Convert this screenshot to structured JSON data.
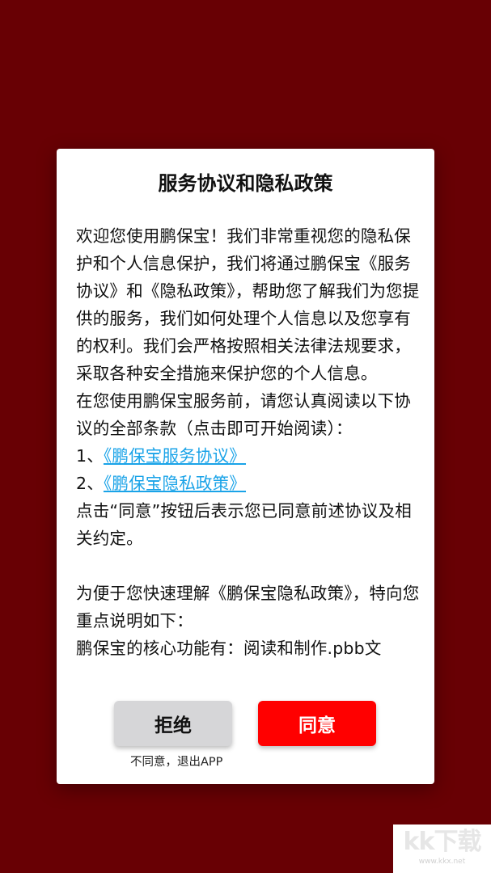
{
  "dialog": {
    "title": "服务协议和隐私政策",
    "paragraphs": [
      "欢迎您使用鹏保宝！我们非常重视您的隐私保护和个人信息保护，我们将通过鹏保宝《服务协议》和《隐私政策》，帮助您了解我们为您提供的服务，我们如何处理个人信息以及您享有的权利。我们会严格按照相关法律法规要求，采取各种安全措施来保护您的个人信息。",
      "在您使用鹏保宝服务前，请您认真阅读以下协议的全部条款（点击即可开始阅读）："
    ],
    "links": [
      {
        "prefix": "1、",
        "label": "《鹏保宝服务协议》"
      },
      {
        "prefix": "2、",
        "label": "《鹏保宝隐私政策》"
      }
    ],
    "after_links": "点击“同意”按钮后表示您已同意前述协议及相关约定。",
    "section2": [
      "为便于您快速理解《鹏保宝隐私政策》，特向您重点说明如下：",
      "鹏保宝的核心功能有：阅读和制作.pbb文"
    ],
    "reject_label": "拒绝",
    "agree_label": "同意",
    "reject_hint": "不同意，退出APP"
  },
  "watermark": {
    "text": "kk下载",
    "url": "www.kkx.net"
  },
  "colors": {
    "background": "#680004",
    "agree_button": "#ff0000",
    "reject_button": "#d6d6d8",
    "link": "#1aa3e8"
  }
}
